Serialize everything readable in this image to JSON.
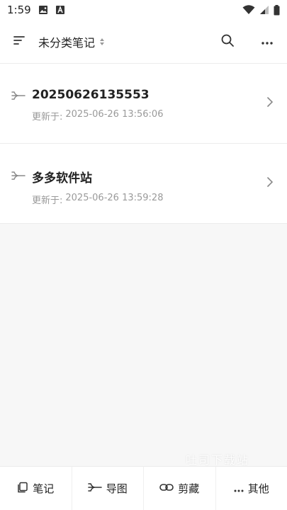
{
  "status_bar": {
    "time": "1:59",
    "icons": [
      "image-icon",
      "a-letter-icon",
      "wifi-icon",
      "signal-icon",
      "battery-icon"
    ]
  },
  "app_bar": {
    "title": "未分类笔记",
    "icons": [
      "menu-icon",
      "sort-icon",
      "search-icon",
      "more-icon"
    ]
  },
  "notes": [
    {
      "name": "20250626135553",
      "meta_label": "更新于:",
      "updated": "2025-06-26 13:56:06"
    },
    {
      "name": "多多软件站",
      "meta_label": "更新于:",
      "updated": "2025-06-26 13:59:28"
    }
  ],
  "bottom_nav": {
    "tabs": [
      {
        "label": "笔记",
        "icon": "note-icon"
      },
      {
        "label": "导图",
        "icon": "mindmap-icon"
      },
      {
        "label": "剪藏",
        "icon": "link-icon"
      },
      {
        "label": "其他",
        "icon": "more-icon"
      }
    ]
  },
  "watermark": "吐司下载站",
  "colors": {
    "background": "#f7f7f7",
    "surface": "#ffffff",
    "text": "#222222",
    "meta_text": "#9a9a9a",
    "divider": "#ececec"
  }
}
